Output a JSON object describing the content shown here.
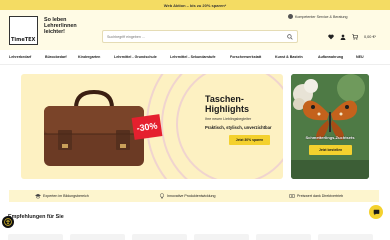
{
  "promo": {
    "text": "Web Aktion – bis zu 20% sparen*"
  },
  "header": {
    "logo_text": "TimeTEX",
    "slogan": "So leben Lehrer/innen leichter!",
    "search_placeholder": "Suchbegriff eingeben …",
    "consult_label": "Kompetenter Service & Beratung",
    "cart_total": "0,00 €*"
  },
  "nav": {
    "items": [
      "Lehrerbedarf",
      "Büroobedarf",
      "Kindergarten",
      "Lehrmittel - Grundschule",
      "Lehrmittel - Sekundarstufe",
      "Forscherwerkstatt",
      "Kunst & Basteln",
      "Aufbewahrung",
      "NEU"
    ]
  },
  "hero": {
    "title": "Taschen-Highlights",
    "subtitle": "Ihre neuen Lieblingsbegleiter",
    "tagline": "Praktisch, stylisch, unverzichtbar",
    "button": "Jetzt 30% sparen",
    "discount": "-30%"
  },
  "side_banner": {
    "label": "Schmetterlings-Zuchtsets",
    "button": "Jetzt bestellen"
  },
  "benefits": [
    {
      "text": "Experten im Bildungsbereich",
      "icon": "graduation-cap-icon"
    },
    {
      "text": "Innovative Produktentwicklung",
      "icon": "lightbulb-icon"
    },
    {
      "text": "Preiswert dank Direktvertrieb",
      "icon": "money-icon"
    }
  ],
  "recommendations": {
    "title": "Empfehlungen für Sie"
  },
  "colors": {
    "accent": "#f4d12e",
    "promo": "#f4dc63",
    "discount": "#e5202e",
    "header_bg": "#fffbe5"
  }
}
